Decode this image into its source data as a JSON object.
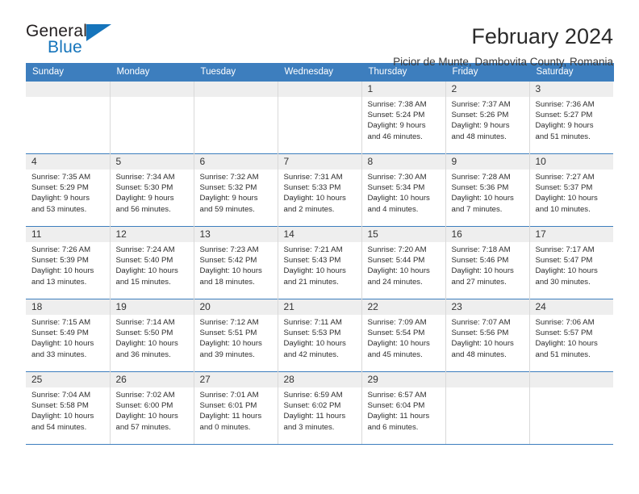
{
  "brand": {
    "word_one": "General",
    "word_two": "Blue",
    "triangle_color": "#1574bb",
    "text_color": "#231f20"
  },
  "header": {
    "title": "February 2024",
    "subtitle": "Picior de Munte, Dambovita County, Romania"
  },
  "theme": {
    "header_bg": "#3d7ebe",
    "header_text": "#ffffff",
    "daynum_bg": "#eeeeee",
    "cell_bg": "#ffffff",
    "row_rule": "#3d7ebe",
    "col_rule": "#d9d9d9"
  },
  "weekdays": [
    "Sunday",
    "Monday",
    "Tuesday",
    "Wednesday",
    "Thursday",
    "Friday",
    "Saturday"
  ],
  "labels": {
    "sunrise_prefix": "Sunrise:",
    "sunset_prefix": "Sunset:",
    "daylight_prefix": "Daylight:"
  },
  "weeks": [
    [
      {
        "blank": true
      },
      {
        "blank": true
      },
      {
        "blank": true
      },
      {
        "blank": true
      },
      {
        "day": "1",
        "sunrise": "Sunrise: 7:38 AM",
        "sunset": "Sunset: 5:24 PM",
        "daylight_line1": "Daylight: 9 hours",
        "daylight_line2": "and 46 minutes."
      },
      {
        "day": "2",
        "sunrise": "Sunrise: 7:37 AM",
        "sunset": "Sunset: 5:26 PM",
        "daylight_line1": "Daylight: 9 hours",
        "daylight_line2": "and 48 minutes."
      },
      {
        "day": "3",
        "sunrise": "Sunrise: 7:36 AM",
        "sunset": "Sunset: 5:27 PM",
        "daylight_line1": "Daylight: 9 hours",
        "daylight_line2": "and 51 minutes."
      }
    ],
    [
      {
        "day": "4",
        "sunrise": "Sunrise: 7:35 AM",
        "sunset": "Sunset: 5:29 PM",
        "daylight_line1": "Daylight: 9 hours",
        "daylight_line2": "and 53 minutes."
      },
      {
        "day": "5",
        "sunrise": "Sunrise: 7:34 AM",
        "sunset": "Sunset: 5:30 PM",
        "daylight_line1": "Daylight: 9 hours",
        "daylight_line2": "and 56 minutes."
      },
      {
        "day": "6",
        "sunrise": "Sunrise: 7:32 AM",
        "sunset": "Sunset: 5:32 PM",
        "daylight_line1": "Daylight: 9 hours",
        "daylight_line2": "and 59 minutes."
      },
      {
        "day": "7",
        "sunrise": "Sunrise: 7:31 AM",
        "sunset": "Sunset: 5:33 PM",
        "daylight_line1": "Daylight: 10 hours",
        "daylight_line2": "and 2 minutes."
      },
      {
        "day": "8",
        "sunrise": "Sunrise: 7:30 AM",
        "sunset": "Sunset: 5:34 PM",
        "daylight_line1": "Daylight: 10 hours",
        "daylight_line2": "and 4 minutes."
      },
      {
        "day": "9",
        "sunrise": "Sunrise: 7:28 AM",
        "sunset": "Sunset: 5:36 PM",
        "daylight_line1": "Daylight: 10 hours",
        "daylight_line2": "and 7 minutes."
      },
      {
        "day": "10",
        "sunrise": "Sunrise: 7:27 AM",
        "sunset": "Sunset: 5:37 PM",
        "daylight_line1": "Daylight: 10 hours",
        "daylight_line2": "and 10 minutes."
      }
    ],
    [
      {
        "day": "11",
        "sunrise": "Sunrise: 7:26 AM",
        "sunset": "Sunset: 5:39 PM",
        "daylight_line1": "Daylight: 10 hours",
        "daylight_line2": "and 13 minutes."
      },
      {
        "day": "12",
        "sunrise": "Sunrise: 7:24 AM",
        "sunset": "Sunset: 5:40 PM",
        "daylight_line1": "Daylight: 10 hours",
        "daylight_line2": "and 15 minutes."
      },
      {
        "day": "13",
        "sunrise": "Sunrise: 7:23 AM",
        "sunset": "Sunset: 5:42 PM",
        "daylight_line1": "Daylight: 10 hours",
        "daylight_line2": "and 18 minutes."
      },
      {
        "day": "14",
        "sunrise": "Sunrise: 7:21 AM",
        "sunset": "Sunset: 5:43 PM",
        "daylight_line1": "Daylight: 10 hours",
        "daylight_line2": "and 21 minutes."
      },
      {
        "day": "15",
        "sunrise": "Sunrise: 7:20 AM",
        "sunset": "Sunset: 5:44 PM",
        "daylight_line1": "Daylight: 10 hours",
        "daylight_line2": "and 24 minutes."
      },
      {
        "day": "16",
        "sunrise": "Sunrise: 7:18 AM",
        "sunset": "Sunset: 5:46 PM",
        "daylight_line1": "Daylight: 10 hours",
        "daylight_line2": "and 27 minutes."
      },
      {
        "day": "17",
        "sunrise": "Sunrise: 7:17 AM",
        "sunset": "Sunset: 5:47 PM",
        "daylight_line1": "Daylight: 10 hours",
        "daylight_line2": "and 30 minutes."
      }
    ],
    [
      {
        "day": "18",
        "sunrise": "Sunrise: 7:15 AM",
        "sunset": "Sunset: 5:49 PM",
        "daylight_line1": "Daylight: 10 hours",
        "daylight_line2": "and 33 minutes."
      },
      {
        "day": "19",
        "sunrise": "Sunrise: 7:14 AM",
        "sunset": "Sunset: 5:50 PM",
        "daylight_line1": "Daylight: 10 hours",
        "daylight_line2": "and 36 minutes."
      },
      {
        "day": "20",
        "sunrise": "Sunrise: 7:12 AM",
        "sunset": "Sunset: 5:51 PM",
        "daylight_line1": "Daylight: 10 hours",
        "daylight_line2": "and 39 minutes."
      },
      {
        "day": "21",
        "sunrise": "Sunrise: 7:11 AM",
        "sunset": "Sunset: 5:53 PM",
        "daylight_line1": "Daylight: 10 hours",
        "daylight_line2": "and 42 minutes."
      },
      {
        "day": "22",
        "sunrise": "Sunrise: 7:09 AM",
        "sunset": "Sunset: 5:54 PM",
        "daylight_line1": "Daylight: 10 hours",
        "daylight_line2": "and 45 minutes."
      },
      {
        "day": "23",
        "sunrise": "Sunrise: 7:07 AM",
        "sunset": "Sunset: 5:56 PM",
        "daylight_line1": "Daylight: 10 hours",
        "daylight_line2": "and 48 minutes."
      },
      {
        "day": "24",
        "sunrise": "Sunrise: 7:06 AM",
        "sunset": "Sunset: 5:57 PM",
        "daylight_line1": "Daylight: 10 hours",
        "daylight_line2": "and 51 minutes."
      }
    ],
    [
      {
        "day": "25",
        "sunrise": "Sunrise: 7:04 AM",
        "sunset": "Sunset: 5:58 PM",
        "daylight_line1": "Daylight: 10 hours",
        "daylight_line2": "and 54 minutes."
      },
      {
        "day": "26",
        "sunrise": "Sunrise: 7:02 AM",
        "sunset": "Sunset: 6:00 PM",
        "daylight_line1": "Daylight: 10 hours",
        "daylight_line2": "and 57 minutes."
      },
      {
        "day": "27",
        "sunrise": "Sunrise: 7:01 AM",
        "sunset": "Sunset: 6:01 PM",
        "daylight_line1": "Daylight: 11 hours",
        "daylight_line2": "and 0 minutes."
      },
      {
        "day": "28",
        "sunrise": "Sunrise: 6:59 AM",
        "sunset": "Sunset: 6:02 PM",
        "daylight_line1": "Daylight: 11 hours",
        "daylight_line2": "and 3 minutes."
      },
      {
        "day": "29",
        "sunrise": "Sunrise: 6:57 AM",
        "sunset": "Sunset: 6:04 PM",
        "daylight_line1": "Daylight: 11 hours",
        "daylight_line2": "and 6 minutes."
      },
      {
        "blank": true
      },
      {
        "blank": true
      }
    ]
  ]
}
